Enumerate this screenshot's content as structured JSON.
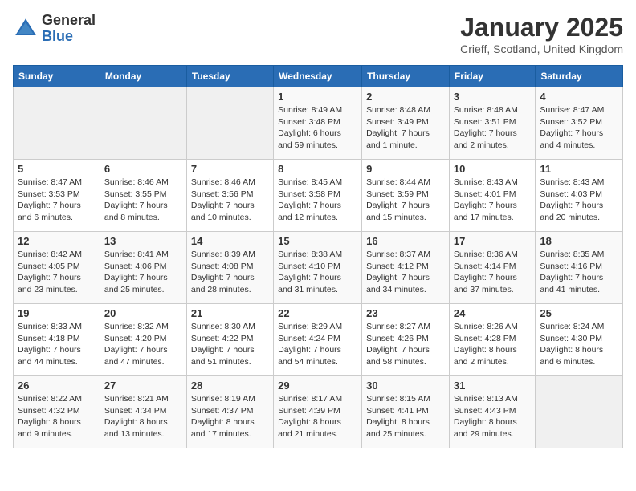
{
  "header": {
    "logo_general": "General",
    "logo_blue": "Blue",
    "title": "January 2025",
    "location": "Crieff, Scotland, United Kingdom"
  },
  "weekdays": [
    "Sunday",
    "Monday",
    "Tuesday",
    "Wednesday",
    "Thursday",
    "Friday",
    "Saturday"
  ],
  "weeks": [
    [
      {
        "day": "",
        "info": ""
      },
      {
        "day": "",
        "info": ""
      },
      {
        "day": "",
        "info": ""
      },
      {
        "day": "1",
        "info": "Sunrise: 8:49 AM\nSunset: 3:48 PM\nDaylight: 6 hours\nand 59 minutes."
      },
      {
        "day": "2",
        "info": "Sunrise: 8:48 AM\nSunset: 3:49 PM\nDaylight: 7 hours\nand 1 minute."
      },
      {
        "day": "3",
        "info": "Sunrise: 8:48 AM\nSunset: 3:51 PM\nDaylight: 7 hours\nand 2 minutes."
      },
      {
        "day": "4",
        "info": "Sunrise: 8:47 AM\nSunset: 3:52 PM\nDaylight: 7 hours\nand 4 minutes."
      }
    ],
    [
      {
        "day": "5",
        "info": "Sunrise: 8:47 AM\nSunset: 3:53 PM\nDaylight: 7 hours\nand 6 minutes."
      },
      {
        "day": "6",
        "info": "Sunrise: 8:46 AM\nSunset: 3:55 PM\nDaylight: 7 hours\nand 8 minutes."
      },
      {
        "day": "7",
        "info": "Sunrise: 8:46 AM\nSunset: 3:56 PM\nDaylight: 7 hours\nand 10 minutes."
      },
      {
        "day": "8",
        "info": "Sunrise: 8:45 AM\nSunset: 3:58 PM\nDaylight: 7 hours\nand 12 minutes."
      },
      {
        "day": "9",
        "info": "Sunrise: 8:44 AM\nSunset: 3:59 PM\nDaylight: 7 hours\nand 15 minutes."
      },
      {
        "day": "10",
        "info": "Sunrise: 8:43 AM\nSunset: 4:01 PM\nDaylight: 7 hours\nand 17 minutes."
      },
      {
        "day": "11",
        "info": "Sunrise: 8:43 AM\nSunset: 4:03 PM\nDaylight: 7 hours\nand 20 minutes."
      }
    ],
    [
      {
        "day": "12",
        "info": "Sunrise: 8:42 AM\nSunset: 4:05 PM\nDaylight: 7 hours\nand 23 minutes."
      },
      {
        "day": "13",
        "info": "Sunrise: 8:41 AM\nSunset: 4:06 PM\nDaylight: 7 hours\nand 25 minutes."
      },
      {
        "day": "14",
        "info": "Sunrise: 8:39 AM\nSunset: 4:08 PM\nDaylight: 7 hours\nand 28 minutes."
      },
      {
        "day": "15",
        "info": "Sunrise: 8:38 AM\nSunset: 4:10 PM\nDaylight: 7 hours\nand 31 minutes."
      },
      {
        "day": "16",
        "info": "Sunrise: 8:37 AM\nSunset: 4:12 PM\nDaylight: 7 hours\nand 34 minutes."
      },
      {
        "day": "17",
        "info": "Sunrise: 8:36 AM\nSunset: 4:14 PM\nDaylight: 7 hours\nand 37 minutes."
      },
      {
        "day": "18",
        "info": "Sunrise: 8:35 AM\nSunset: 4:16 PM\nDaylight: 7 hours\nand 41 minutes."
      }
    ],
    [
      {
        "day": "19",
        "info": "Sunrise: 8:33 AM\nSunset: 4:18 PM\nDaylight: 7 hours\nand 44 minutes."
      },
      {
        "day": "20",
        "info": "Sunrise: 8:32 AM\nSunset: 4:20 PM\nDaylight: 7 hours\nand 47 minutes."
      },
      {
        "day": "21",
        "info": "Sunrise: 8:30 AM\nSunset: 4:22 PM\nDaylight: 7 hours\nand 51 minutes."
      },
      {
        "day": "22",
        "info": "Sunrise: 8:29 AM\nSunset: 4:24 PM\nDaylight: 7 hours\nand 54 minutes."
      },
      {
        "day": "23",
        "info": "Sunrise: 8:27 AM\nSunset: 4:26 PM\nDaylight: 7 hours\nand 58 minutes."
      },
      {
        "day": "24",
        "info": "Sunrise: 8:26 AM\nSunset: 4:28 PM\nDaylight: 8 hours\nand 2 minutes."
      },
      {
        "day": "25",
        "info": "Sunrise: 8:24 AM\nSunset: 4:30 PM\nDaylight: 8 hours\nand 6 minutes."
      }
    ],
    [
      {
        "day": "26",
        "info": "Sunrise: 8:22 AM\nSunset: 4:32 PM\nDaylight: 8 hours\nand 9 minutes."
      },
      {
        "day": "27",
        "info": "Sunrise: 8:21 AM\nSunset: 4:34 PM\nDaylight: 8 hours\nand 13 minutes."
      },
      {
        "day": "28",
        "info": "Sunrise: 8:19 AM\nSunset: 4:37 PM\nDaylight: 8 hours\nand 17 minutes."
      },
      {
        "day": "29",
        "info": "Sunrise: 8:17 AM\nSunset: 4:39 PM\nDaylight: 8 hours\nand 21 minutes."
      },
      {
        "day": "30",
        "info": "Sunrise: 8:15 AM\nSunset: 4:41 PM\nDaylight: 8 hours\nand 25 minutes."
      },
      {
        "day": "31",
        "info": "Sunrise: 8:13 AM\nSunset: 4:43 PM\nDaylight: 8 hours\nand 29 minutes."
      },
      {
        "day": "",
        "info": ""
      }
    ]
  ]
}
